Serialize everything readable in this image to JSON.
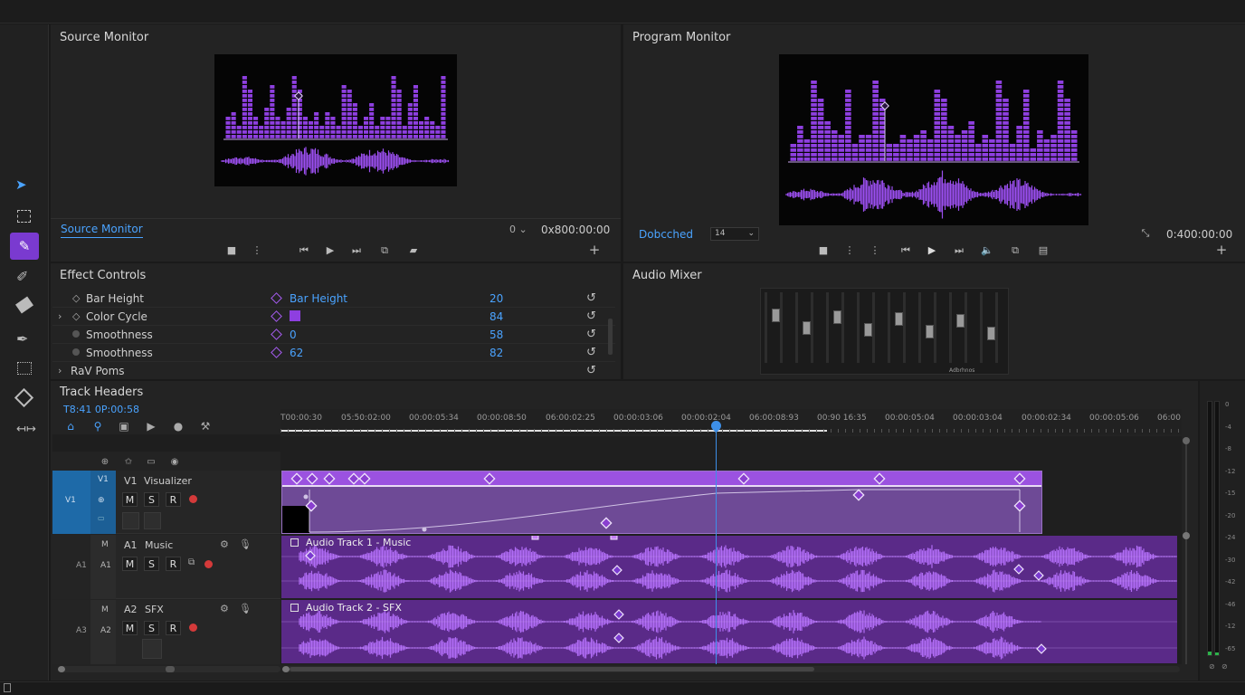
{
  "tools": {
    "items": [
      "selection",
      "marquee",
      "pen",
      "brush",
      "eraser",
      "eyedropper",
      "crop",
      "anchor",
      "ripple"
    ]
  },
  "source_monitor": {
    "title": "Source Monitor",
    "tab_label": "Source Monitor",
    "fit_value": "0",
    "timecode": "0x800:00:00"
  },
  "program_monitor": {
    "title": "Program Monitor",
    "status_label": "Dobcched",
    "zoom_value": "14",
    "timecode": "0:400:00:00"
  },
  "effect_controls": {
    "title": "Effect Controls",
    "rows": [
      {
        "label": "Bar Height",
        "value_label": "Bar Height",
        "value": "20"
      },
      {
        "label": "Color Cycle",
        "value_label": "",
        "value": "84"
      },
      {
        "label": "Smoothness",
        "value_label": "0",
        "value": "58"
      },
      {
        "label": "Smoothness",
        "value_label": "62",
        "value": "82"
      },
      {
        "label": "RaV Poms",
        "value_label": "",
        "value": ""
      }
    ]
  },
  "audio_mixer": {
    "title": "Audio Mixer",
    "footer_label": "Adbrhnos"
  },
  "timeline": {
    "title": "Track Headers",
    "timecode": "T8:41 0P:00:58",
    "ruler": [
      "T00:00:30",
      "05:50:02:00",
      "00:00:05:34",
      "00:00:08:50",
      "06:00:02:25",
      "00:00:03:06",
      "00:00:02:04",
      "06:00:08:93",
      "00:90 16:35",
      "00:00:05:04",
      "00:00:03:04",
      "00:00:02:34",
      "00:00:05:06",
      "06:00"
    ],
    "tracks": [
      {
        "side_label": "V1",
        "id": "V1",
        "name": "Visualizer",
        "toggle_label": "V1"
      },
      {
        "side_label": "A1",
        "id": "A1",
        "name": "Music",
        "toggle_label": "A1"
      },
      {
        "side_label": "A3",
        "id": "A2",
        "name": "SFX",
        "toggle_label": "A2"
      }
    ],
    "mute_label": "M",
    "solo_label": "S",
    "record_label": "R",
    "clips": {
      "audio1": "Audio Track 1 - Music",
      "audio2": "Audio Track 2 - SFX"
    }
  },
  "meter": {
    "scale": [
      "0",
      "-4",
      "-8",
      "-12",
      "-15",
      "-20",
      "-24",
      "-30",
      "-42",
      "-46",
      "-12",
      "-65"
    ]
  },
  "colors": {
    "accent_purple": "#8a3fd0",
    "clip_purple": "#5c2a8a",
    "playhead": "#3d8fe8",
    "bar_purple": "#8e3fe0"
  }
}
